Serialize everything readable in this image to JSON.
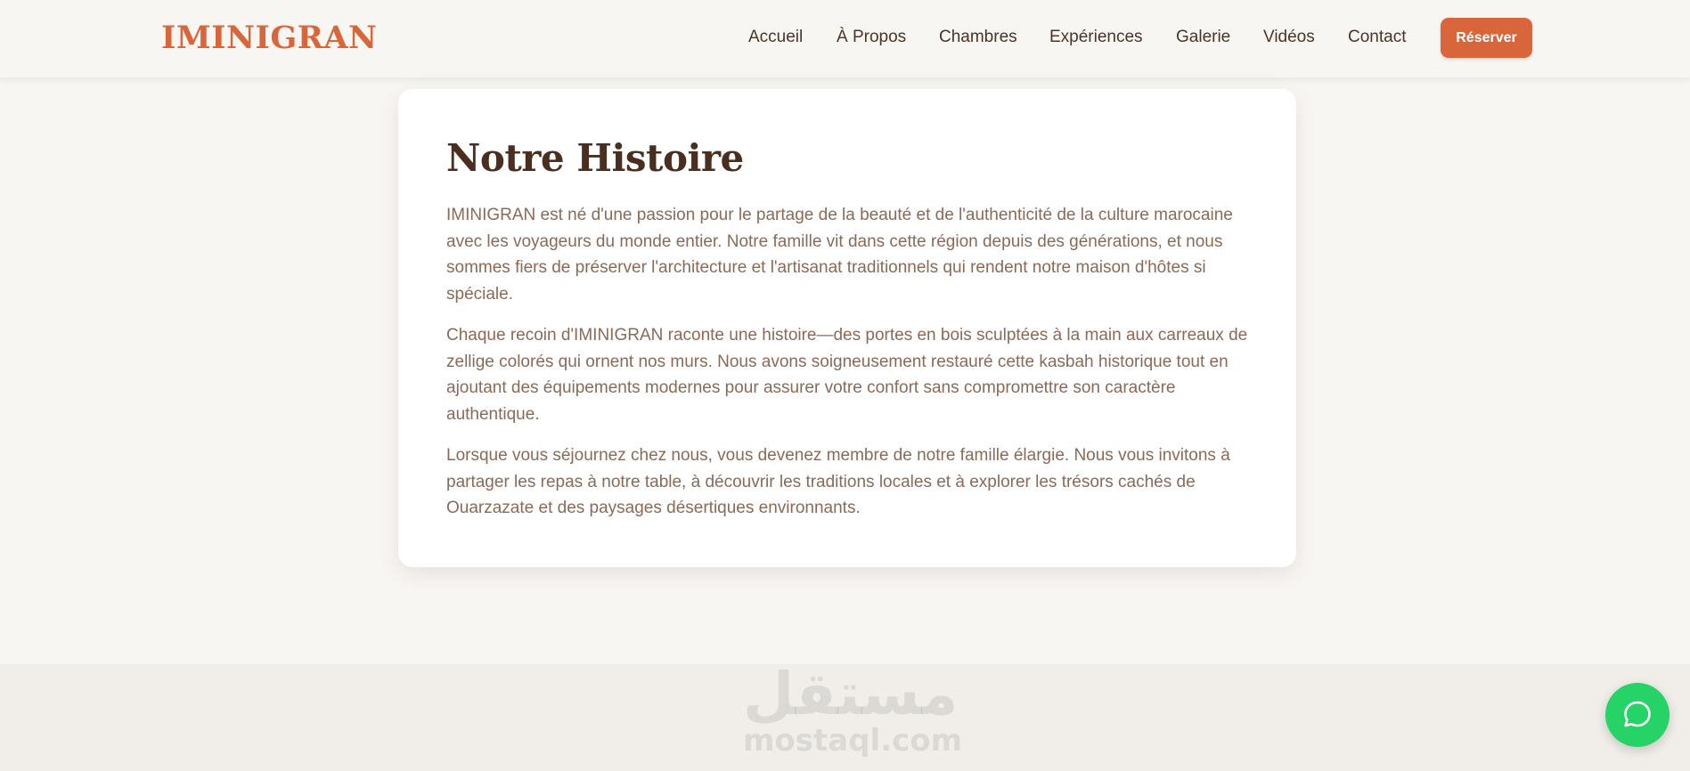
{
  "brand": {
    "name": "IMINIGRAN"
  },
  "nav": {
    "links": [
      "Accueil",
      "À Propos",
      "Chambres",
      "Expériences",
      "Galerie",
      "Vidéos",
      "Contact"
    ],
    "reserve_label": "Réserver"
  },
  "story": {
    "title": "Notre Histoire",
    "paragraphs": [
      "IMINIGRAN est né d'une passion pour le partage de la beauté et de l'authenticité de la culture marocaine avec les voyageurs du monde entier. Notre famille vit dans cette région depuis des générations, et nous sommes fiers de préserver l'architecture et l'artisanat traditionnels qui rendent notre maison d'hôtes si spéciale.",
      "Chaque recoin d'IMINIGRAN raconte une histoire—des portes en bois sculptées à la main aux carreaux de zellige colorés qui ornent nos murs. Nous avons soigneusement restauré cette kasbah historique tout en ajoutant des équipements modernes pour assurer votre confort sans compromettre son caractère authentique.",
      "Lorsque vous séjournez chez nous, vous devenez membre de notre famille élargie. Nous vous invitons à partager les repas à notre table, à découvrir les traditions locales et à explorer les trésors cachés de Ouarzazate et des paysages désertiques environnants."
    ]
  },
  "watermark": {
    "arabic": "مستقل",
    "latin": "mostaql.com"
  },
  "icons": {
    "whatsapp": "whatsapp-chat-icon"
  },
  "colors": {
    "accent": "#d9653b",
    "whatsapp": "#25d366",
    "heading": "#4a2e1f",
    "body_text": "#8a6a57"
  }
}
